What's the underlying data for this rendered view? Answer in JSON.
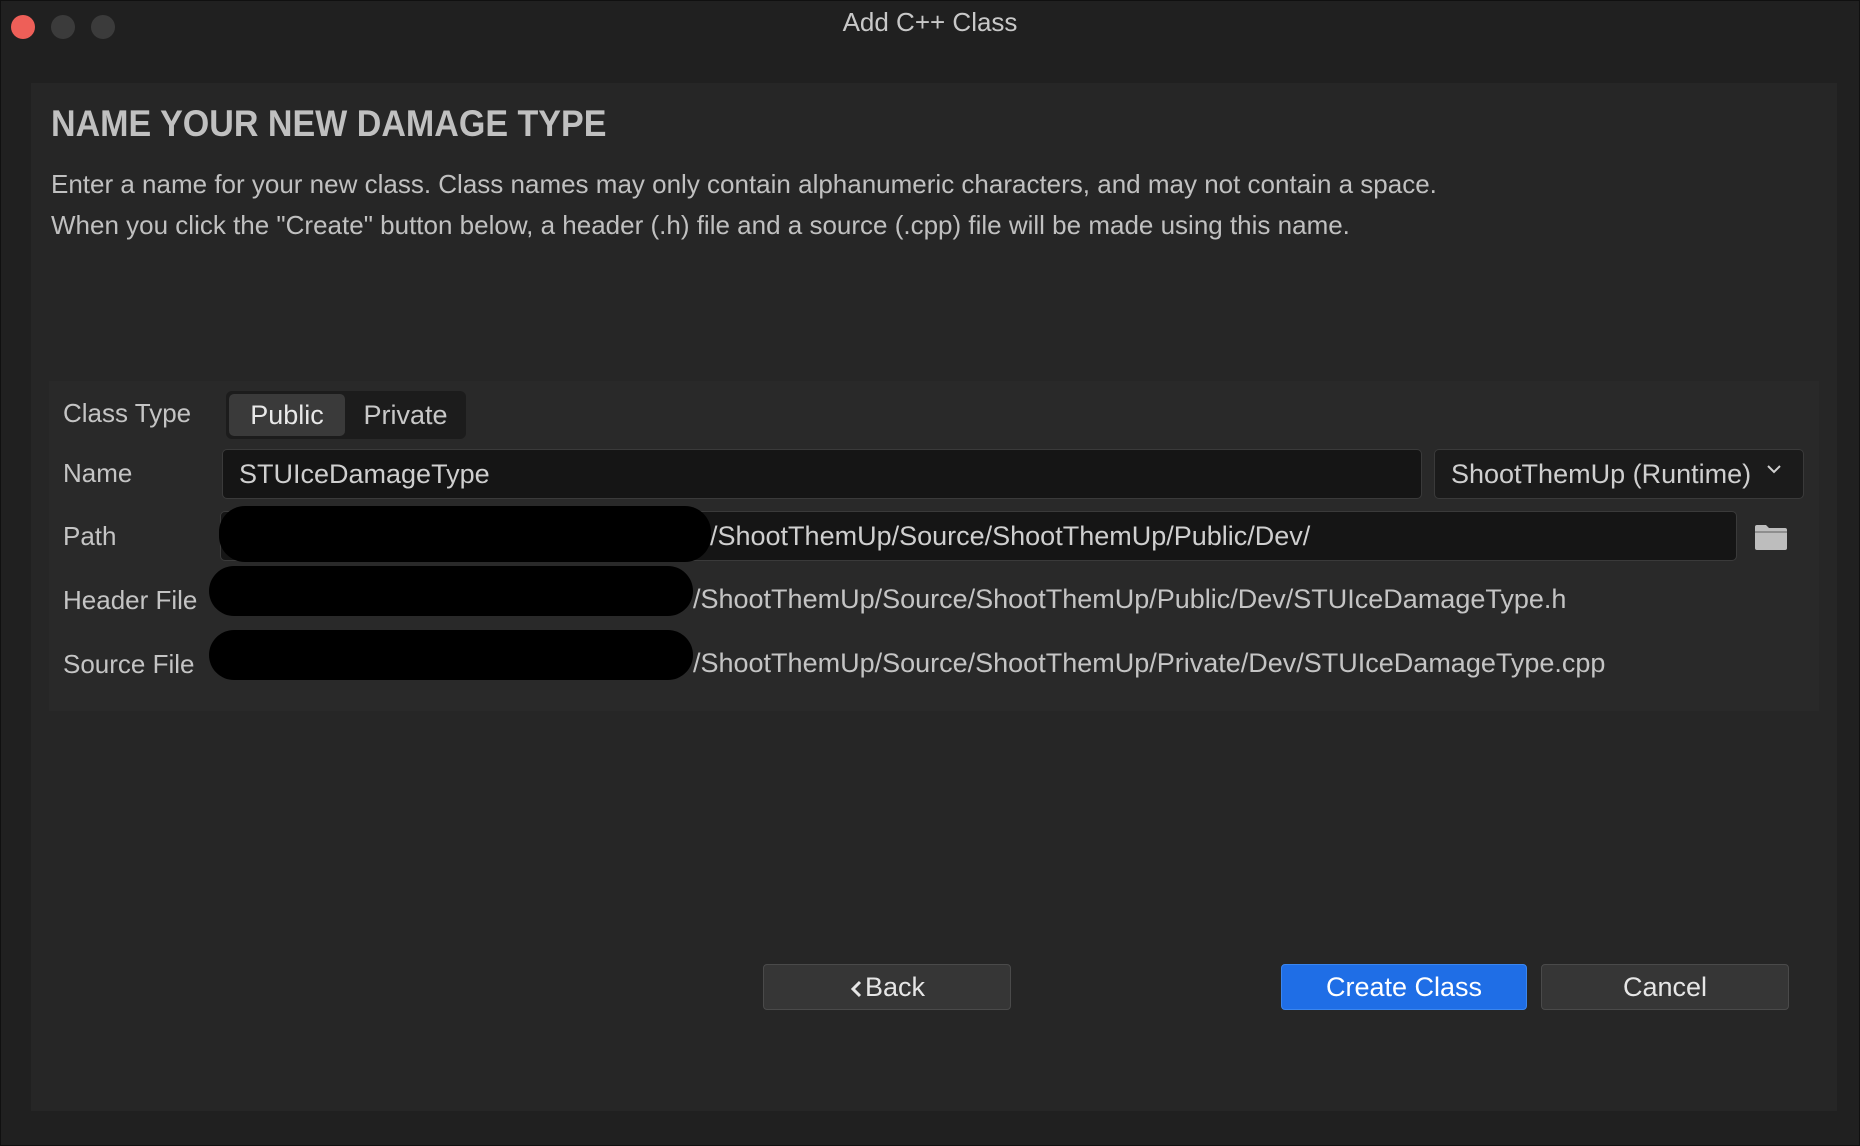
{
  "window": {
    "title": "Add C++ Class"
  },
  "page": {
    "heading": "NAME YOUR NEW DAMAGE TYPE",
    "description_line1": "Enter a name for your new class. Class names may only contain alphanumeric characters, and may not contain a space.",
    "description_line2": "When you click the \"Create\" button below, a header (.h) file and a source (.cpp) file will be made using this name."
  },
  "form": {
    "class_type_label": "Class Type",
    "class_type_options": [
      "Public",
      "Private"
    ],
    "class_type_selected": "Public",
    "name_label": "Name",
    "name_value": "STUIceDamageType",
    "module_value": "ShootThemUp (Runtime)",
    "path_label": "Path",
    "path_value": "/ShootThemUp/Source/ShootThemUp/Public/Dev/",
    "header_label": "Header File",
    "header_value": "/ShootThemUp/Source/ShootThemUp/Public/Dev/STUIceDamageType.h",
    "source_label": "Source File",
    "source_value": "/ShootThemUp/Source/ShootThemUp/Private/Dev/STUIceDamageType.cpp"
  },
  "buttons": {
    "back": "Back",
    "create": "Create Class",
    "cancel": "Cancel"
  },
  "icons": {
    "folder": "folder-icon",
    "chevron": "chevron-down-icon",
    "back": "chevron-left-icon"
  },
  "colors": {
    "accent": "#1f6ee6",
    "close": "#ee5f58"
  }
}
